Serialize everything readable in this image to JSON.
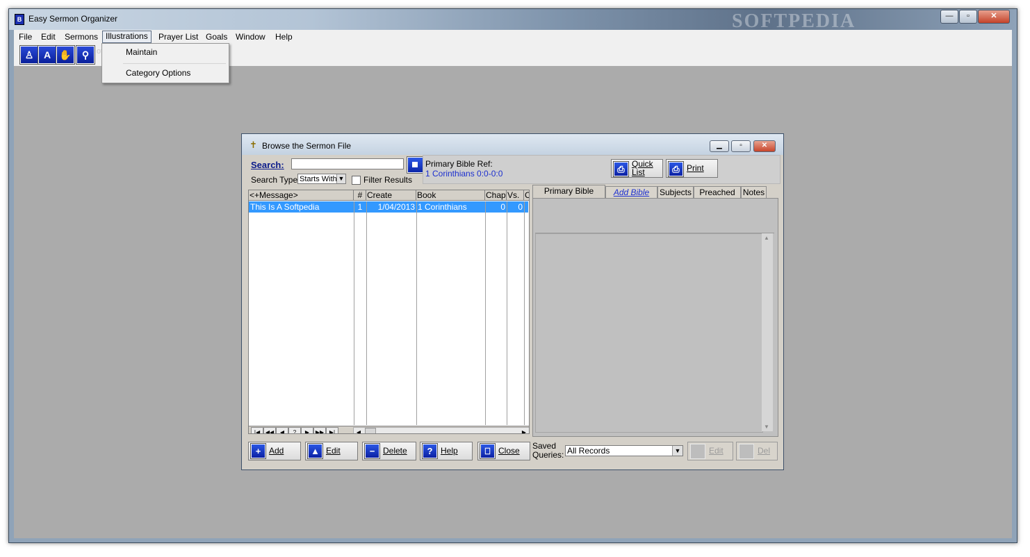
{
  "app": {
    "title": "Easy Sermon Organizer",
    "watermark": "SOFTPEDIA",
    "caption_buttons": [
      "—",
      "▫",
      "✕"
    ]
  },
  "menubar": [
    "File",
    "Edit",
    "Sermons",
    "Illustrations",
    "Prayer List",
    "Goals",
    "Window",
    "Help"
  ],
  "toolbar_icons": [
    "person-icon",
    "lock-document-icon",
    "hands-icon",
    "search-person-icon"
  ],
  "toolbar_watermark": "oftpedia",
  "illustrations_menu": {
    "items": [
      "Maintain",
      "Category Options"
    ]
  },
  "child_window": {
    "title": "Browse the Sermon File",
    "search_label": "Search:",
    "search_value": "",
    "search_type_label": "Search Type:",
    "search_type_value": "Starts With",
    "filter_label": "Filter Results",
    "bible_ref_label": "Primary Bible Ref:",
    "bible_ref_value": "1 Corinthians 0:0-0:0",
    "quick_list_label_1": "Quick",
    "quick_list_label_2": "List",
    "print_label": "Print",
    "grid": {
      "columns": [
        "<+Message>",
        "#",
        "Create",
        "Book",
        "Chap",
        "Vs.",
        "C"
      ],
      "rows": [
        {
          "message": "This Is A Softpedia",
          "num": "1",
          "create": "1/04/2013",
          "book": "1 Corinthians",
          "chap": "0",
          "vs": "0"
        }
      ]
    },
    "nav_buttons": [
      "|◀",
      "◀◀",
      "◀",
      "?",
      "▶",
      "▶▶",
      "▶|"
    ],
    "tabs": [
      "Primary Bible Quote",
      "Add Bible Ref",
      "Subjects",
      "Preached @",
      "Notes"
    ],
    "bottom_buttons": {
      "add": "Add",
      "edit": "Edit",
      "delete": "Delete",
      "help": "Help",
      "close": "Close"
    },
    "saved_queries_label_1": "Saved",
    "saved_queries_label_2": "Queries:",
    "saved_queries_value": "All Records",
    "query_edit": "Edit",
    "query_del": "Del"
  },
  "colors": {
    "selection": "#3399ff",
    "link_blue": "#1c2fcf",
    "mdi_background": "#ababab"
  }
}
